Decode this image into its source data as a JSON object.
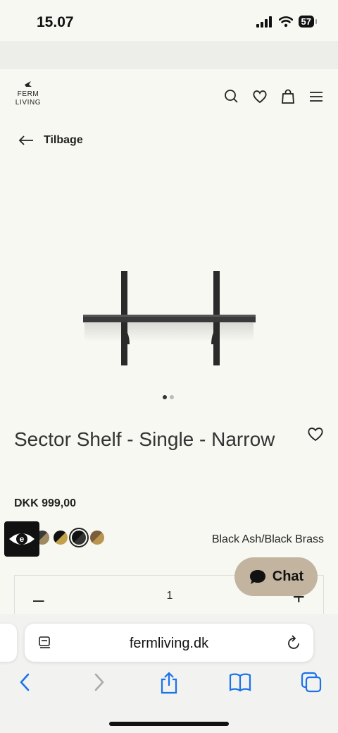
{
  "status": {
    "time": "15.07",
    "battery": "57"
  },
  "header": {
    "logo_line1": "FERM",
    "logo_line2": "LIVING",
    "icons": [
      "search-icon",
      "heart-icon",
      "bag-icon",
      "menu-icon"
    ]
  },
  "nav": {
    "back_label": "Tilbage"
  },
  "gallery": {
    "count": 2,
    "active": 0
  },
  "product": {
    "title": "Sector Shelf - Single - Narrow",
    "price": "DKK 999,00",
    "selected_variant": "Black Ash/Black Brass",
    "swatches": [
      {
        "name": "swatch-black-brass-1",
        "colors": [
          "#3a3a3a",
          "#a08a62"
        ],
        "selected": false
      },
      {
        "name": "swatch-black-gold",
        "colors": [
          "#111111",
          "#c2a14a"
        ],
        "selected": false
      },
      {
        "name": "swatch-black-black",
        "colors": [
          "#111111",
          "#333333"
        ],
        "selected": true
      },
      {
        "name": "swatch-brown-brass",
        "colors": [
          "#7a5d3b",
          "#b9954f"
        ],
        "selected": false
      }
    ]
  },
  "quantity": {
    "value": "1",
    "minus": "–",
    "plus": "+"
  },
  "chat": {
    "label": "Chat",
    "color": "#c3b49f"
  },
  "browser": {
    "url": "fermliving.dk"
  }
}
